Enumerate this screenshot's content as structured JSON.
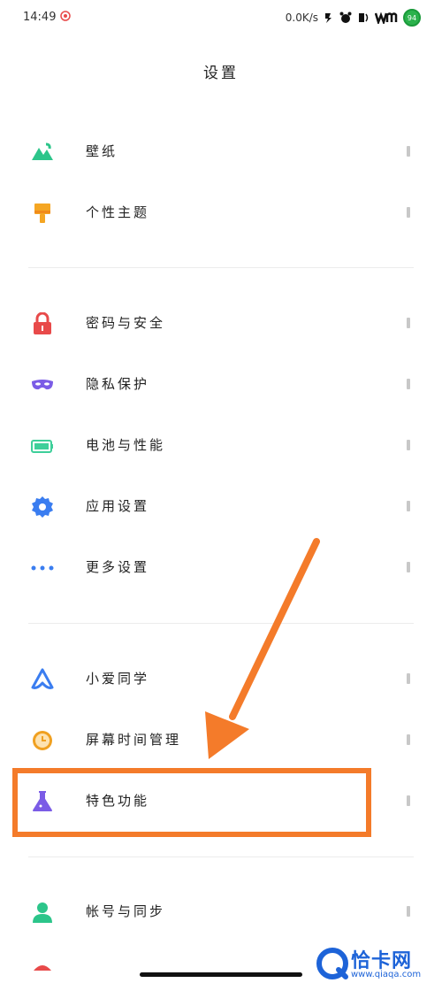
{
  "status_bar": {
    "time": "14:49",
    "network_speed": "0.0K/s",
    "battery_level": "94"
  },
  "header": {
    "title": "设置"
  },
  "sections": [
    {
      "items": [
        {
          "label": "壁纸",
          "icon": "wallpaper-icon",
          "color": "#2cc58a"
        },
        {
          "label": "个性主题",
          "icon": "theme-brush-icon",
          "color": "#f5a623"
        }
      ]
    },
    {
      "items": [
        {
          "label": "密码与安全",
          "icon": "lock-icon",
          "color": "#e84a4a"
        },
        {
          "label": "隐私保护",
          "icon": "privacy-mask-icon",
          "color": "#7b5ce6"
        },
        {
          "label": "电池与性能",
          "icon": "battery-icon",
          "color": "#3ecf9a"
        },
        {
          "label": "应用设置",
          "icon": "gear-icon",
          "color": "#3a7df0"
        },
        {
          "label": "更多设置",
          "icon": "more-dots-icon",
          "color": "#3a7df0"
        }
      ]
    },
    {
      "items": [
        {
          "label": "小爱同学",
          "icon": "xiaoai-icon",
          "color": "#3a7df0"
        },
        {
          "label": "屏幕时间管理",
          "icon": "clock-icon",
          "color": "#f0a020"
        },
        {
          "label": "特色功能",
          "icon": "flask-icon",
          "color": "#7b5ce6"
        }
      ]
    },
    {
      "items": [
        {
          "label": "帐号与同步",
          "icon": "account-icon",
          "color": "#2cc58a"
        }
      ]
    }
  ],
  "annotation": {
    "highlight_color": "#f47b2a"
  },
  "watermark": {
    "brand": "恰卡网",
    "url": "www.qiaqa.com"
  }
}
